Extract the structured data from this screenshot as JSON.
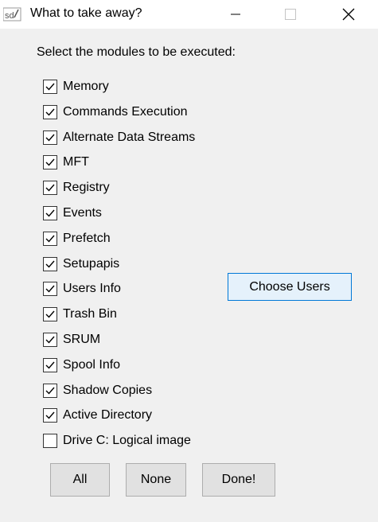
{
  "window": {
    "title": "What to take away?",
    "icon": "app-icon",
    "minimize_icon": "minimize-icon",
    "maximize_icon": "maximize-icon",
    "close_icon": "close-icon"
  },
  "prompt": "Select the modules to be executed:",
  "modules": [
    {
      "label": "Memory",
      "checked": true
    },
    {
      "label": "Commands Execution",
      "checked": true
    },
    {
      "label": "Alternate Data Streams",
      "checked": true
    },
    {
      "label": "MFT",
      "checked": true
    },
    {
      "label": "Registry",
      "checked": true
    },
    {
      "label": "Events",
      "checked": true
    },
    {
      "label": "Prefetch",
      "checked": true
    },
    {
      "label": "Setupapis",
      "checked": true
    },
    {
      "label": "Users Info",
      "checked": true
    },
    {
      "label": "Trash Bin",
      "checked": true
    },
    {
      "label": "SRUM",
      "checked": true
    },
    {
      "label": "Spool Info",
      "checked": true
    },
    {
      "label": "Shadow Copies",
      "checked": true
    },
    {
      "label": "Active Directory",
      "checked": true
    },
    {
      "label": "Drive C: Logical image",
      "checked": false
    }
  ],
  "buttons": {
    "choose_users": "Choose Users",
    "all": "All",
    "none": "None",
    "done": "Done!"
  },
  "colors": {
    "window_bg": "#f0f0f0",
    "titlebar_bg": "#ffffff",
    "accent": "#0078d7"
  }
}
